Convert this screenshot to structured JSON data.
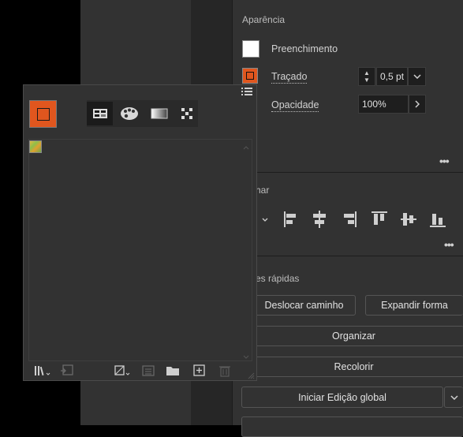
{
  "appearance": {
    "title": "Aparência",
    "fill_label": "Preenchimento",
    "stroke_label": "Traçado",
    "stroke_weight": "0,5 pt",
    "opacity_label": "Opacidade",
    "opacity_value": "100%"
  },
  "align": {
    "title_partial": "har"
  },
  "quick_actions": {
    "title_partial": "es rápidas",
    "offset_path": "Deslocar caminho",
    "expand_shape": "Expandir forma",
    "arrange": "Organizar",
    "recolor": "Recolorir",
    "global_edit": "Iniciar Edição global"
  },
  "colors": {
    "stroke_accent": "#e0561e",
    "panel_bg": "#323232",
    "field_bg": "#1e1e1e"
  }
}
